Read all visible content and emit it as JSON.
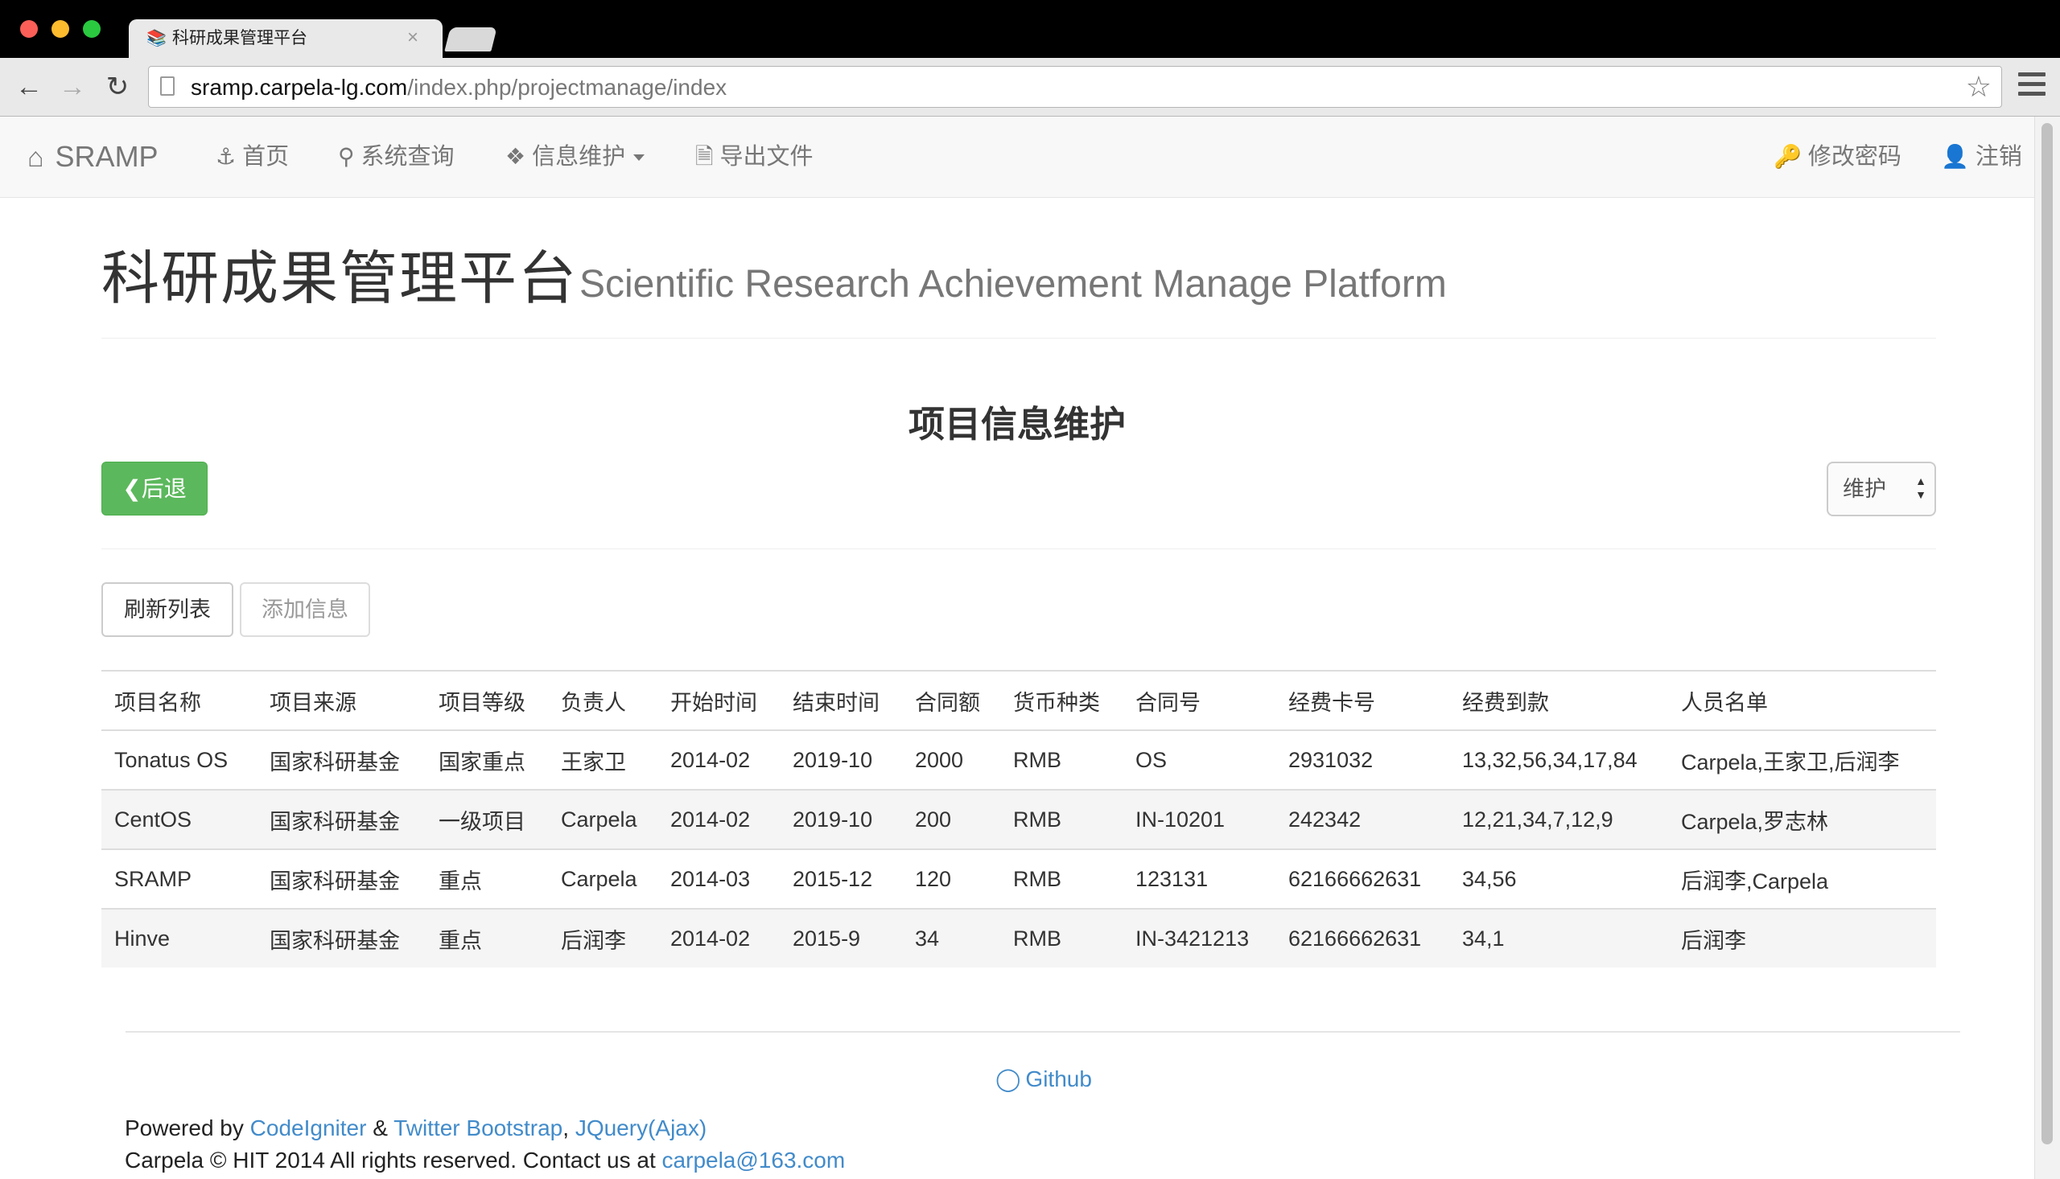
{
  "browser": {
    "tab_title": "科研成果管理平台",
    "tab_close": "×",
    "url_host": "sramp.carpela-lg.com",
    "url_path": "/index.php/projectmanage/index"
  },
  "navbar": {
    "brand": "SRAMP",
    "items": [
      {
        "label": "首页",
        "icon": "anchor-icon"
      },
      {
        "label": "系统查询",
        "icon": "search-icon"
      },
      {
        "label": "信息维护",
        "icon": "tags-icon"
      },
      {
        "label": "导出文件",
        "icon": "file-icon"
      }
    ],
    "right_items": [
      {
        "label": "修改密码",
        "icon": "key-icon"
      },
      {
        "label": "注销",
        "icon": "user-icon"
      }
    ]
  },
  "header": {
    "title_cn": "科研成果管理平台",
    "title_en": "Scientific Research Achievement Manage Platform"
  },
  "section_title": "项目信息维护",
  "actions": {
    "back_label": "后退",
    "mode_select_value": "维护",
    "refresh_label": "刷新列表",
    "add_label": "添加信息"
  },
  "table": {
    "columns": [
      "项目名称",
      "项目来源",
      "项目等级",
      "负责人",
      "开始时间",
      "结束时间",
      "合同额",
      "货币种类",
      "合同号",
      "经费卡号",
      "经费到款",
      "人员名单"
    ],
    "rows": [
      [
        "Tonatus OS",
        "国家科研基金",
        "国家重点",
        "王家卫",
        "2014-02",
        "2019-10",
        "2000",
        "RMB",
        "OS",
        "2931032",
        "13,32,56,34,17,84",
        "Carpela,王家卫,后润李"
      ],
      [
        "CentOS",
        "国家科研基金",
        "一级项目",
        "Carpela",
        "2014-02",
        "2019-10",
        "200",
        "RMB",
        "IN-10201",
        "242342",
        "12,21,34,7,12,9",
        "Carpela,罗志林"
      ],
      [
        "SRAMP",
        "国家科研基金",
        "重点",
        "Carpela",
        "2014-03",
        "2015-12",
        "120",
        "RMB",
        "123131",
        "62166662631",
        "34,56",
        "后润李,Carpela"
      ],
      [
        "Hinve",
        "国家科研基金",
        "重点",
        "后润李",
        "2014-02",
        "2015-9",
        "34",
        "RMB",
        "IN-3421213",
        "62166662631",
        "34,1",
        "后润李"
      ]
    ]
  },
  "footer": {
    "github_label": "Github",
    "powered_by": "Powered by",
    "link_codeigniter": "CodeIgniter",
    "amp": "&",
    "link_bootstrap": "Twitter Bootstrap",
    "comma": ",",
    "link_jquery": "JQuery(Ajax)",
    "copyright": "Carpela © HIT 2014 All rights reserved. Contact us at",
    "email": "carpela@163.com"
  }
}
